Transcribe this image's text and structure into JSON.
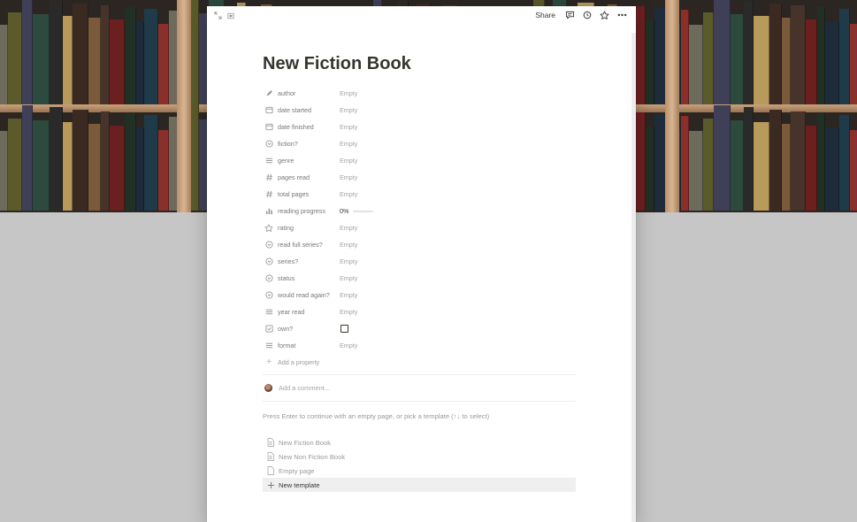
{
  "page": {
    "title": "New Fiction Book"
  },
  "topbar": {
    "share_label": "Share",
    "icons": [
      "expand-icon",
      "peek-mode-icon",
      "comment-icon",
      "history-icon",
      "favorite-star-icon",
      "more-icon"
    ]
  },
  "properties": [
    {
      "name": "author",
      "icon": "pencil-icon",
      "value": "Empty"
    },
    {
      "name": "date started",
      "icon": "calendar-icon",
      "value": "Empty"
    },
    {
      "name": "date finished",
      "icon": "calendar-icon",
      "value": "Empty"
    },
    {
      "name": "fiction?",
      "icon": "select-icon",
      "value": "Empty"
    },
    {
      "name": "genre",
      "icon": "multi-select-icon",
      "value": "Empty"
    },
    {
      "name": "pages read",
      "icon": "number-icon",
      "value": "Empty"
    },
    {
      "name": "total pages",
      "icon": "number-icon",
      "value": "Empty"
    },
    {
      "name": "reading progress",
      "icon": "formula-chart-icon",
      "value": "0%",
      "progress": 0
    },
    {
      "name": "rating",
      "icon": "star-icon",
      "value": "Empty"
    },
    {
      "name": "read full series?",
      "icon": "select-icon",
      "value": "Empty"
    },
    {
      "name": "series?",
      "icon": "select-icon",
      "value": "Empty"
    },
    {
      "name": "status",
      "icon": "select-icon",
      "value": "Empty"
    },
    {
      "name": "would read again?",
      "icon": "select-icon",
      "value": "Empty"
    },
    {
      "name": "year read",
      "icon": "multi-select-icon",
      "value": "Empty"
    },
    {
      "name": "own?",
      "icon": "checkbox-property-icon",
      "value": "",
      "checked": false
    },
    {
      "name": "format",
      "icon": "multi-select-icon",
      "value": "Empty"
    }
  ],
  "add_property_label": "Add a property",
  "comment": {
    "placeholder": "Add a comment..."
  },
  "hint": "Press Enter to continue with an empty page, or pick a template (↑↓ to select)",
  "templates": [
    {
      "label": "New Fiction Book",
      "icon": "page-icon"
    },
    {
      "label": "New Non Fiction Book",
      "icon": "page-icon"
    },
    {
      "label": "Empty page",
      "icon": "blank-page-icon"
    },
    {
      "label": "New template",
      "icon": "plus-icon"
    }
  ],
  "colors": {
    "text": "#37352f",
    "muted": "#9b9a97",
    "highlight_row": "#efefef"
  }
}
